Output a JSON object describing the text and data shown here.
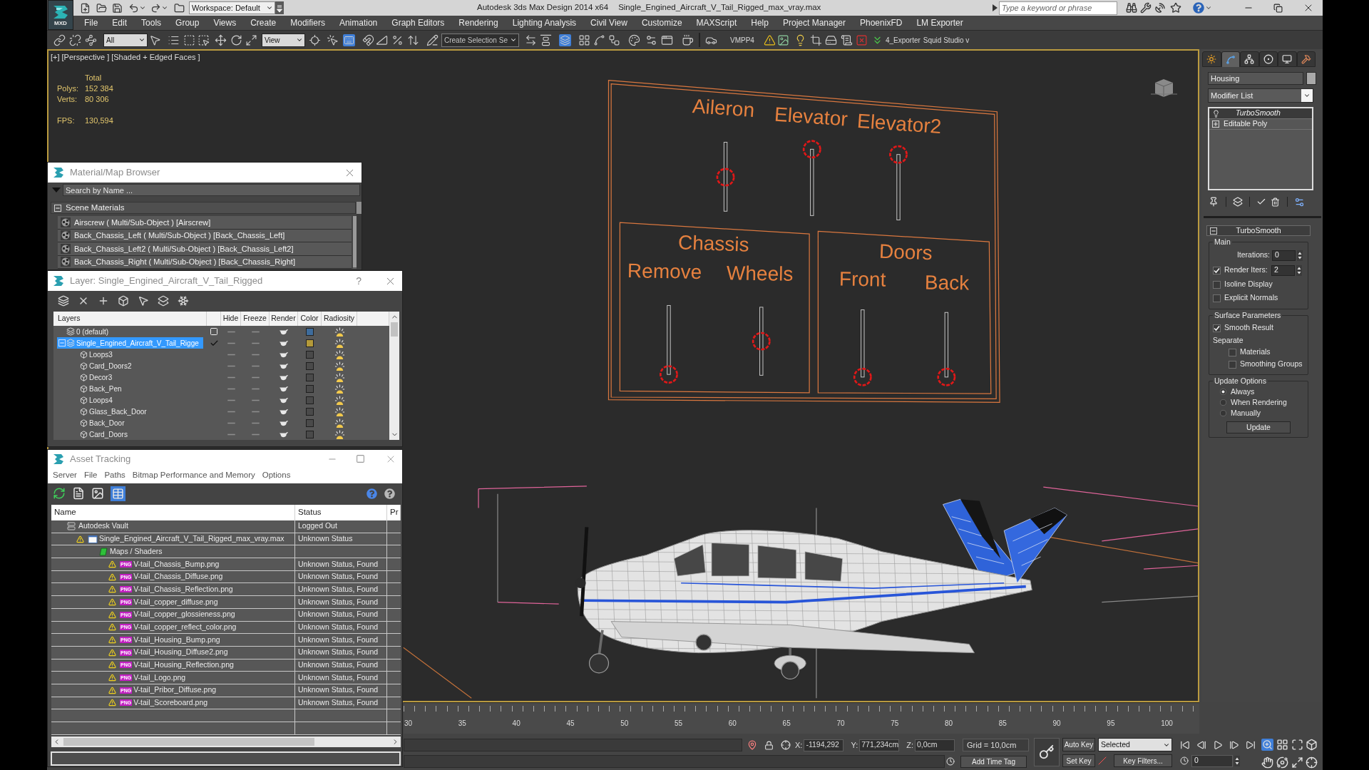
{
  "title_bar": {
    "workspace": "Workspace: Default",
    "app_title": "Autodesk 3ds Max Design 2014 x64",
    "file_name": "Single_Engined_Aircraft_V_Tail_Rigged_max_vray.max",
    "search": {
      "placeholder": "Type a keyword or phrase"
    }
  },
  "logo": {
    "text": "MXD"
  },
  "menu": [
    "File",
    "Edit",
    "Tools",
    "Group",
    "Views",
    "Create",
    "Modifiers",
    "Animation",
    "Graph Editors",
    "Rendering",
    "Lighting Analysis",
    "Civil View",
    "Customize",
    "MAXScript",
    "Help",
    "Project Manager",
    "PhoenixFD",
    "LM Exporter"
  ],
  "toolbar": {
    "selection_filter": "All",
    "coordinate_system": "View",
    "named_selection": "Create Selection Se",
    "macro_labels": [
      "VMPP4",
      "4_Exporter",
      "Squid Studio v"
    ],
    "buttons": [
      {
        "active": false
      },
      {
        "active": false
      },
      {
        "active": false
      },
      {
        "active": false
      },
      {
        "active": false
      },
      {
        "active": false
      },
      {
        "active": false
      },
      {
        "active": false
      },
      {
        "active": false
      },
      {
        "active": false
      },
      {
        "active": false
      },
      {
        "active": false
      },
      {
        "active": true
      },
      {
        "active": false
      },
      {
        "active": false
      },
      {
        "active": false
      },
      {
        "active": false
      },
      {
        "active": false
      },
      {
        "active": false
      },
      {
        "active": false
      },
      {
        "active": true
      },
      {
        "active": false
      },
      {
        "active": false
      },
      {
        "active": false
      },
      {
        "active": false
      },
      {
        "active": false
      },
      {
        "active": false
      },
      {
        "active": false
      },
      {
        "active": false
      },
      {
        "active": false
      },
      {
        "active": false
      },
      {
        "active": false
      },
      {
        "active": false
      },
      {
        "active": false
      },
      {
        "active": false
      },
      {
        "active": false
      },
      {
        "active": false
      }
    ]
  },
  "viewport": {
    "menus": [
      "[+]",
      "[Perspective ]",
      "[Shaded + Edged Faces ]"
    ],
    "stats": {
      "heading": "Total",
      "rows": [
        {
          "label": "Polys:",
          "value": "152 384"
        },
        {
          "label": "Verts:",
          "value": "80 306"
        }
      ],
      "fps": {
        "label": "FPS:",
        "value": "130,594"
      }
    },
    "rig_panel": {
      "sliders": [
        {
          "label": "Aileron"
        },
        {
          "label": "Elevator"
        },
        {
          "label": "Elevator2"
        }
      ],
      "groups": [
        {
          "title": "Chassis",
          "sliders": [
            {
              "label": "Remove"
            },
            {
              "label": "Wheels"
            }
          ]
        },
        {
          "title": "Doors",
          "sliders": [
            {
              "label": "Front"
            },
            {
              "label": "Back"
            }
          ]
        }
      ]
    }
  },
  "command_panel": {
    "tabs": [
      {
        "selected": false
      },
      {
        "selected": true
      },
      {
        "selected": false
      },
      {
        "selected": false
      },
      {
        "selected": false
      },
      {
        "selected": false
      }
    ],
    "object_name": "Housing",
    "modifier_list": "Modifier List",
    "stack": [
      {
        "name": "TurboSmooth",
        "kind": "modifier",
        "selected": true
      },
      {
        "name": "Editable Poly",
        "kind": "base",
        "selected": false
      }
    ],
    "rollout": {
      "title": "TurboSmooth",
      "expanded": true,
      "groups": [
        {
          "title": "Main",
          "controls": [
            {
              "kind": "spinner",
              "label": "Iterations:",
              "value": "0"
            },
            {
              "kind": "check_spinner",
              "label": "Render Iters:",
              "checked": true,
              "value": "2"
            },
            {
              "kind": "checkbox",
              "label": "Isoline Display",
              "checked": false
            },
            {
              "kind": "checkbox",
              "label": "Explicit Normals",
              "checked": false
            }
          ]
        },
        {
          "title": "Surface Parameters",
          "controls": [
            {
              "kind": "checkbox",
              "label": "Smooth Result",
              "checked": true
            },
            {
              "kind": "text",
              "label": "Separate"
            },
            {
              "kind": "subcheckbox",
              "label": "Materials",
              "checked": false
            },
            {
              "kind": "subcheckbox",
              "label": "Smoothing Groups",
              "checked": false
            }
          ]
        },
        {
          "title": "Update Options",
          "controls": [
            {
              "kind": "radio",
              "label": "Always",
              "selected": true
            },
            {
              "kind": "radio",
              "label": "When Rendering",
              "selected": false
            },
            {
              "kind": "radio",
              "label": "Manually",
              "selected": false
            },
            {
              "kind": "button",
              "label": "Update"
            }
          ]
        }
      ]
    }
  },
  "material_browser": {
    "title": "Material/Map Browser",
    "search": {
      "placeholder": "Search by Name ..."
    },
    "group": {
      "title": "Scene Materials",
      "expanded": true,
      "items": [
        "Airscrew ( Multi/Sub-Object ) [Airscrew]",
        "Back_Chassis_Left ( Multi/Sub-Object ) [Back_Chassis_Left]",
        "Back_Chassis_Left2 ( Multi/Sub-Object ) [Back_Chassis_Left2]",
        "Back_Chassis_Right ( Multi/Sub-Object ) [Back_Chassis_Right]"
      ]
    }
  },
  "layer_manager": {
    "title": "Layer: Single_Engined_Aircraft_V_Tail_Rigged",
    "help": "?",
    "columns": [
      "Layers",
      "Hide",
      "Freeze",
      "Render",
      "Color",
      "Radiosity"
    ],
    "layers": [
      {
        "name": "0 (default)",
        "selected": false,
        "current": false,
        "hidden": false,
        "frozen": false,
        "color": "#3e6c9c"
      },
      {
        "name": "Single_Engined_Aircraft_V_Tail_Rigge",
        "selected": true,
        "current": true,
        "expanded": true,
        "hidden": false,
        "frozen": false,
        "color": "#b49a3a",
        "children": [
          {
            "name": "Loops3",
            "selected": false,
            "hidden": false,
            "frozen": false
          },
          {
            "name": "Card_Doors2",
            "selected": false,
            "hidden": false,
            "frozen": false
          },
          {
            "name": "Decor3",
            "selected": false,
            "hidden": false,
            "frozen": false
          },
          {
            "name": "Back_Pen",
            "selected": false,
            "hidden": false,
            "frozen": false
          },
          {
            "name": "Loops4",
            "selected": false,
            "hidden": false,
            "frozen": false
          },
          {
            "name": "Glass_Back_Door",
            "selected": false,
            "hidden": false,
            "frozen": false
          },
          {
            "name": "Back_Door",
            "selected": false,
            "hidden": false,
            "frozen": false
          },
          {
            "name": "Card_Doors",
            "selected": false,
            "hidden": false,
            "frozen": false
          }
        ]
      }
    ]
  },
  "asset_tracking": {
    "title": "Asset Tracking",
    "menu": [
      "Server",
      "File",
      "Paths",
      "Bitmap Performance and Memory",
      "Options"
    ],
    "toolbar": [
      {
        "active": false
      },
      {
        "active": false
      },
      {
        "active": false
      },
      {
        "active": true
      }
    ],
    "columns": [
      "Name",
      "Status",
      "Pr"
    ],
    "tree": [
      {
        "name": "Autodesk Vault",
        "status": "Logged Out",
        "kind": "vault",
        "warning": false,
        "children": [
          {
            "name": "Single_Engined_Aircraft_V_Tail_Rigged_max_vray.max",
            "status": "Unknown Status",
            "kind": "scene",
            "warning": true,
            "children": [
              {
                "name": "Maps / Shaders",
                "kind": "folder",
                "warning": false,
                "children": [
                  {
                    "name": "V-tail_Chassis_Bump.png",
                    "status": "Unknown Status, Found",
                    "kind": "png",
                    "badge": "PNG",
                    "warning": true
                  },
                  {
                    "name": "V-tail_Chassis_Diffuse.png",
                    "status": "Unknown Status, Found",
                    "kind": "png",
                    "badge": "PNG",
                    "warning": true
                  },
                  {
                    "name": "V-tail_Chassis_Reflection.png",
                    "status": "Unknown Status, Found",
                    "kind": "png",
                    "badge": "PNG",
                    "warning": true
                  },
                  {
                    "name": "V-tail_copper_diffuse.png",
                    "status": "Unknown Status, Found",
                    "kind": "png",
                    "badge": "PNG",
                    "warning": true
                  },
                  {
                    "name": "V-tail_copper_glossieness.png",
                    "status": "Unknown Status, Found",
                    "kind": "png",
                    "badge": "PNG",
                    "warning": true
                  },
                  {
                    "name": "V-tail_copper_reflect_color.png",
                    "status": "Unknown Status, Found",
                    "kind": "png",
                    "badge": "PNG",
                    "warning": true
                  },
                  {
                    "name": "V-tail_Housing_Bump.png",
                    "status": "Unknown Status, Found",
                    "kind": "png",
                    "badge": "PNG",
                    "warning": true
                  },
                  {
                    "name": "V-tail_Housing_Diffuse2.png",
                    "status": "Unknown Status, Found",
                    "kind": "png",
                    "badge": "PNG",
                    "warning": true
                  },
                  {
                    "name": "V-tail_Housing_Reflection.png",
                    "status": "Unknown Status, Found",
                    "kind": "png",
                    "badge": "PNG",
                    "warning": true
                  },
                  {
                    "name": "V-tail_Logo.png",
                    "status": "Unknown Status, Found",
                    "kind": "png",
                    "badge": "PNG",
                    "warning": true
                  },
                  {
                    "name": "V-tail_Pribor_Diffuse.png",
                    "status": "Unknown Status, Found",
                    "kind": "png",
                    "badge": "PNG",
                    "warning": true
                  },
                  {
                    "name": "V-tail_Scoreboard.png",
                    "status": "Unknown Status, Found",
                    "kind": "png",
                    "badge": "PNG",
                    "warning": true
                  }
                ]
              }
            ]
          }
        ]
      }
    ]
  },
  "timeline": {
    "ticks": [
      "30",
      "35",
      "40",
      "45",
      "50",
      "55",
      "60",
      "65",
      "70",
      "75",
      "80",
      "85",
      "90",
      "95",
      "100"
    ]
  },
  "status_bar": {
    "coords": [
      {
        "label": "X:",
        "value": "-1194,292"
      },
      {
        "label": "Y:",
        "value": "771,234cm"
      },
      {
        "label": "Z:",
        "value": "0,0cm"
      }
    ],
    "grid": "Grid = 10,0cm",
    "add_time_tag": "Add Time Tag",
    "auto_key": "Auto Key",
    "set_key": "Set Key",
    "key_mode": "Selected",
    "key_filters": "Key Filters...",
    "frame": "0",
    "view_controls": [
      {
        "active": true
      },
      {
        "active": false
      },
      {
        "active": false
      },
      {
        "active": false
      },
      {
        "active": false
      },
      {
        "active": false
      },
      {
        "active": false
      },
      {
        "active": false
      }
    ]
  }
}
